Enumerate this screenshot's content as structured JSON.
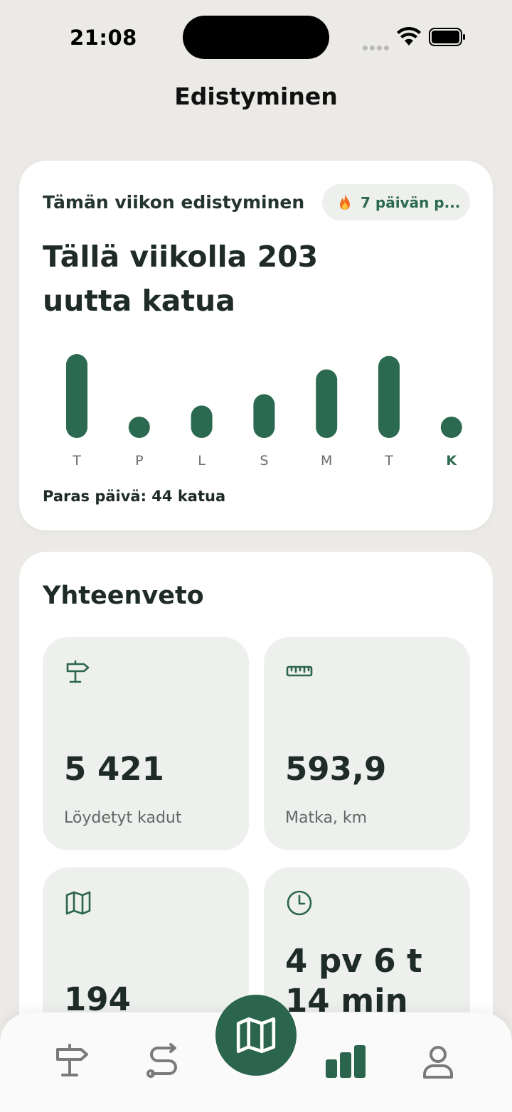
{
  "status_bar": {
    "time": "21:08"
  },
  "page": {
    "title": "Edistyminen"
  },
  "week": {
    "heading": "Tämän viikon edistyminen",
    "streak_label": "7 päivän p...",
    "headline": "Tällä viikolla 203 uutta katua",
    "best_day": "Paras päivä: 44 katua",
    "colors": {
      "bar": "#2B6A50",
      "label": "#6B6B6B",
      "today_label": "#2B6A50"
    }
  },
  "chart_data": {
    "type": "bar",
    "categories": [
      "T",
      "P",
      "L",
      "S",
      "M",
      "T",
      "K"
    ],
    "values": [
      44,
      11,
      17,
      23,
      36,
      43,
      10
    ],
    "ylim": [
      0,
      44
    ],
    "highlight_index": 6,
    "grid": false
  },
  "summary": {
    "heading": "Yhteenveto",
    "tiles": [
      {
        "icon": "signpost-icon",
        "value": "5 421",
        "label": "Löydetyt kadut"
      },
      {
        "icon": "ruler-icon",
        "value": "593,9",
        "label": "Matka, km"
      },
      {
        "icon": "map-icon",
        "value": "194",
        "label": ""
      },
      {
        "icon": "clock-icon",
        "value": "4 pv 6 t 14 min",
        "label": ""
      }
    ]
  },
  "nav": {
    "items": [
      "signpost-icon",
      "route-icon",
      "map-icon",
      "stats-icon",
      "profile-icon"
    ],
    "active": "stats-icon",
    "accent": "#2B654E"
  }
}
